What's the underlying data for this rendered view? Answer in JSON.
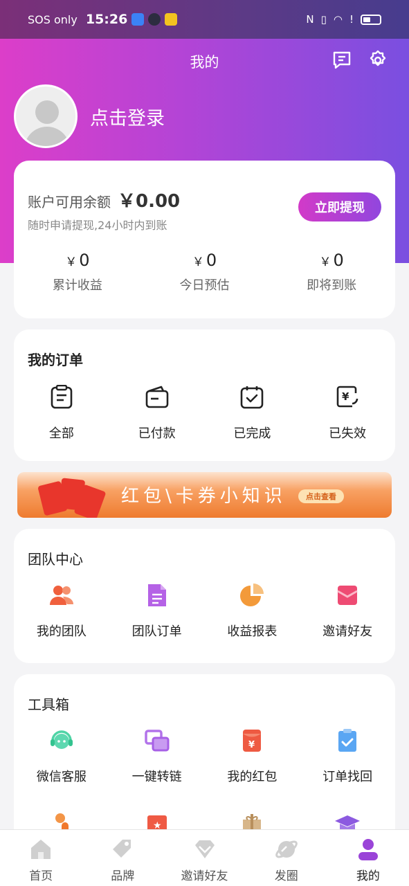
{
  "status_bar": {
    "left_text": "SOS only",
    "time": "15:26",
    "right_text": "N"
  },
  "header": {
    "title": "我的",
    "icons": [
      "message-icon",
      "settings-icon"
    ]
  },
  "profile": {
    "login_text": "点击登录"
  },
  "balance": {
    "label": "账户可用余额",
    "amount": "￥0.00",
    "sub": "随时申请提现,24小时内到账",
    "withdraw_label": "立即提现",
    "stats": [
      {
        "currency": "￥",
        "value": "0",
        "label": "累计收益"
      },
      {
        "currency": "￥",
        "value": "0",
        "label": "今日预估"
      },
      {
        "currency": "￥",
        "value": "0",
        "label": "即将到账"
      }
    ]
  },
  "orders": {
    "title": "我的订单",
    "items": [
      {
        "label": "全部",
        "icon": "clipboard-list-icon"
      },
      {
        "label": "已付款",
        "icon": "wallet-icon"
      },
      {
        "label": "已完成",
        "icon": "clipboard-check-icon"
      },
      {
        "label": "已失效",
        "icon": "yen-refresh-icon"
      }
    ]
  },
  "banner": {
    "text": "红包\\卡券小知识",
    "cta": "点击查看"
  },
  "team": {
    "title": "团队中心",
    "items": [
      {
        "label": "我的团队",
        "icon": "team-icon"
      },
      {
        "label": "团队订单",
        "icon": "document-icon"
      },
      {
        "label": "收益报表",
        "icon": "pie-chart-icon"
      },
      {
        "label": "邀请好友",
        "icon": "invite-envelope-icon"
      }
    ]
  },
  "tools": {
    "title": "工具箱",
    "items": [
      {
        "label": "微信客服",
        "icon": "headset-icon"
      },
      {
        "label": "一键转链",
        "icon": "convert-link-icon"
      },
      {
        "label": "我的红包",
        "icon": "red-packet-icon"
      },
      {
        "label": "订单找回",
        "icon": "order-retrieve-icon"
      }
    ]
  },
  "tabbar": {
    "items": [
      {
        "label": "首页",
        "icon": "home-icon"
      },
      {
        "label": "品牌",
        "icon": "brand-tag-icon"
      },
      {
        "label": "邀请好友",
        "icon": "diamond-icon"
      },
      {
        "label": "发圈",
        "icon": "planet-icon"
      },
      {
        "label": "我的",
        "icon": "user-icon"
      }
    ],
    "active_index": 4
  },
  "colors": {
    "gradient_start": "#dc3ec9",
    "gradient_end": "#7a4fe0",
    "active_tab": "#9a44d8"
  }
}
